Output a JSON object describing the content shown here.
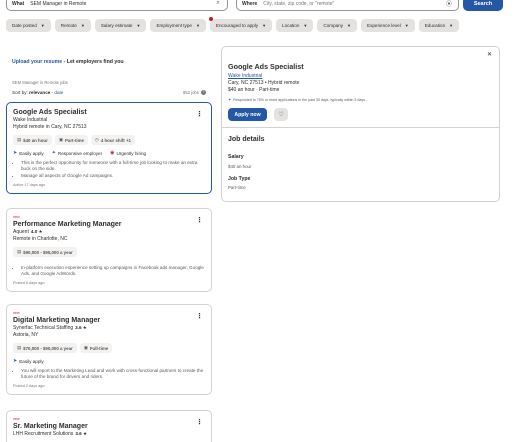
{
  "search": {
    "what_label": "What",
    "what_value": "SEM Manager in Remote",
    "where_label": "Where",
    "where_placeholder": "City, state, zip code, or \"remote\"",
    "button": "Search"
  },
  "filters": [
    "Date posted",
    "Remote",
    "Salary estimate",
    "Employment type",
    "Encouraged to apply",
    "Location",
    "Company",
    "Experience level",
    "Education"
  ],
  "upload": {
    "link": "Upload your resume",
    "text": " - Let employers find you"
  },
  "results": {
    "jobs_for": "SEM Manager in Remote jobs",
    "sort_label": "Sort by: ",
    "sort_selected": "relevance",
    "sort_sep": " - ",
    "sort_other": "date",
    "count": "853 jobs"
  },
  "jobs": [
    {
      "new": "",
      "title": "Google Ads Specialist",
      "company": "Wake Industrial",
      "rating": "",
      "location": "Hybrid remote in Cary, NC 27513",
      "tags": [
        "$40 an hour",
        "Part-time",
        "4 hour shift +1"
      ],
      "perks": [
        "Easily apply",
        "Responsive employer",
        "Urgently hiring"
      ],
      "bullets": [
        "This is the perfect opportunity for someone with a full-time job looking to make an extra buck on the side.",
        "Manage all aspects of Google Ad campaigns."
      ],
      "posted": "Active 17 days ago"
    },
    {
      "new": "new",
      "title": "Performance Marketing Manager",
      "company": "Aquent",
      "rating": "4.0 ★",
      "location": "Remote in Charlotte, NC",
      "tags": [
        "$90,000 - $95,000 a year"
      ],
      "perks": [],
      "bullets": [
        "In-platform execution experience setting up campaigns in Facebook ads manager, Google Ads, and Google AdWords."
      ],
      "posted": "Posted 6 days ago"
    },
    {
      "new": "new",
      "title": "Digital Marketing Manager",
      "company": "Synerfac Technical Staffing",
      "rating": "3.6 ★",
      "location": "Astoria, NY",
      "tags": [
        "$70,000 - $90,000 a year",
        "Full-time"
      ],
      "perks": [
        "Easily apply"
      ],
      "bullets": [
        "You will report to the Marketing Lead and work with cross-functional partners to create the future of the brand for drivers and riders."
      ],
      "posted": "Posted 2 days ago"
    },
    {
      "new": "new",
      "title": "Sr. Marketing Manager",
      "company": "LHH Recruitment Solutions",
      "rating": "3.6 ★",
      "location": "",
      "tags": [],
      "perks": [],
      "bullets": [],
      "posted": ""
    }
  ],
  "detail": {
    "title": "Google Ads Specialist",
    "company": "Wake Industrial",
    "location": "Cary, NC 27513  •  Hybrid remote",
    "pay": "$40 an hour  ·  Part-time",
    "responded": "Responded to 75% or more applications in the past 30 days, typically within 3 days.",
    "apply": "Apply now",
    "details_heading": "Job details",
    "salary_label": "Salary",
    "salary_value": "$40 an hour",
    "jobtype_label": "Job Type",
    "jobtype_value": "Part-time"
  },
  "colors": {
    "accent": "#2557a7",
    "new": "#c91f1f"
  }
}
